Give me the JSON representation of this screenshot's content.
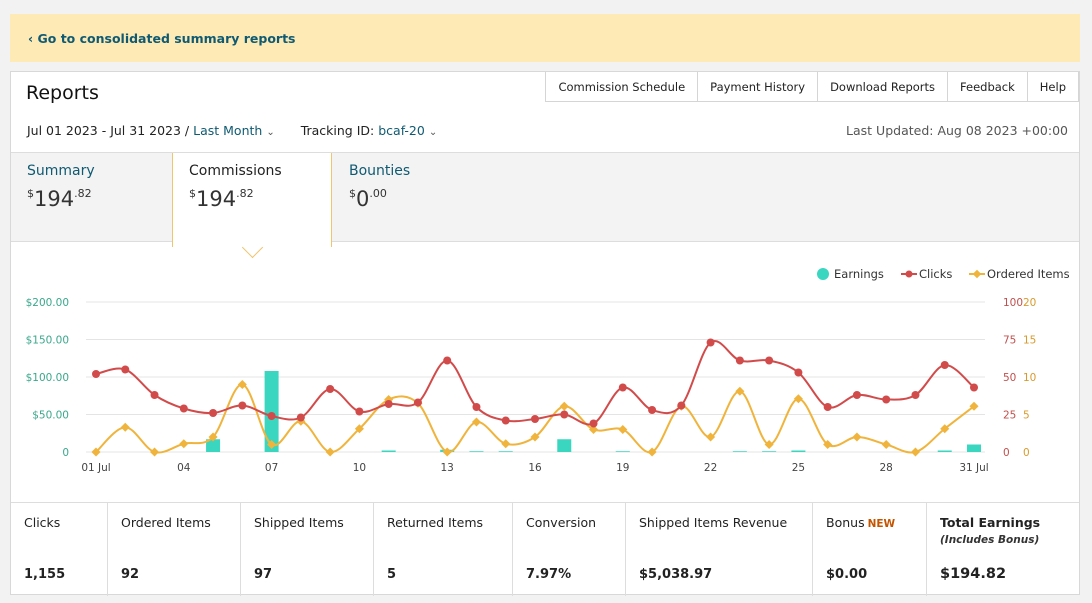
{
  "banner": {
    "link_text": "‹ Go to consolidated summary reports"
  },
  "header": {
    "title": "Reports",
    "nav": [
      "Commission Schedule",
      "Payment History",
      "Download Reports",
      "Feedback",
      "Help"
    ]
  },
  "filters": {
    "date_range": "Jul 01 2023 - Jul 31 2023 /",
    "period": "Last Month",
    "tracking_label": "Tracking ID:",
    "tracking_id": "bcaf-20",
    "last_updated": "Last Updated: Aug 08 2023 +00:00"
  },
  "tabs": [
    {
      "name": "Summary",
      "currency": "$",
      "whole": "194",
      "cents": ".82"
    },
    {
      "name": "Commissions",
      "currency": "$",
      "whole": "194",
      "cents": ".82"
    },
    {
      "name": "Bounties",
      "currency": "$",
      "whole": "0",
      "cents": ".00"
    }
  ],
  "colors": {
    "earnings": "#3ad6c0",
    "clicks": "#d24b4b",
    "ordered": "#f0b43c",
    "link": "#0f5a72"
  },
  "chart_data": {
    "type": "bar+line",
    "legend": [
      "Earnings",
      "Clicks",
      "Ordered Items"
    ],
    "legend_position": "top-right",
    "x": [
      "01 Jul",
      "02",
      "03",
      "04",
      "05",
      "06",
      "07",
      "08",
      "09",
      "10",
      "11",
      "12",
      "13",
      "14",
      "15",
      "16",
      "17",
      "18",
      "19",
      "20",
      "21",
      "22",
      "23",
      "24",
      "25",
      "26",
      "27",
      "28",
      "29",
      "30",
      "31 Jul"
    ],
    "x_tick_labels": [
      "01 Jul",
      "04",
      "07",
      "10",
      "13",
      "16",
      "19",
      "22",
      "25",
      "28",
      "31 Jul"
    ],
    "y_left_ticks": [
      "$200.00",
      "$150.00",
      "$100.00",
      "$50.00",
      "0"
    ],
    "y_left_range": [
      0,
      200
    ],
    "y_clicks_ticks": [
      "100",
      "75",
      "50",
      "25",
      "0"
    ],
    "y_clicks_range": [
      0,
      100
    ],
    "y_ordered_ticks": [
      "20",
      "15",
      "10",
      "5",
      "0"
    ],
    "y_ordered_range": [
      0,
      20
    ],
    "grid": true,
    "series": [
      {
        "name": "Earnings",
        "axis": "left",
        "kind": "bar",
        "values": [
          0,
          0,
          0,
          0,
          17,
          0,
          108,
          0,
          0,
          0,
          2,
          0,
          3,
          1,
          1,
          0,
          17,
          0,
          1,
          0,
          0,
          0,
          1,
          1,
          2,
          0,
          0,
          0,
          0,
          2,
          10
        ]
      },
      {
        "name": "Clicks",
        "axis": "clicks",
        "kind": "line",
        "values": [
          52,
          55,
          38,
          29,
          26,
          31,
          24,
          23,
          42,
          27,
          32,
          33,
          61,
          30,
          21,
          22,
          25,
          19,
          43,
          28,
          31,
          73,
          61,
          61,
          53,
          30,
          38,
          35,
          38,
          58,
          43
        ]
      },
      {
        "name": "Ordered Items",
        "axis": "ordered",
        "kind": "line",
        "values": [
          0,
          3.3,
          0,
          1.1,
          2,
          9,
          1,
          4.1,
          0,
          3.1,
          7,
          6.5,
          0,
          4,
          1.1,
          2,
          6.1,
          3,
          3,
          0,
          6.1,
          2,
          8.1,
          1,
          7.1,
          1,
          2,
          1,
          0,
          3.1,
          6.1
        ]
      }
    ]
  },
  "stats": [
    {
      "label": "Clicks",
      "value": "1,155"
    },
    {
      "label": "Ordered Items",
      "value": "92"
    },
    {
      "label": "Shipped Items",
      "value": "97"
    },
    {
      "label": "Returned Items",
      "value": "5"
    },
    {
      "label": "Conversion",
      "value": "7.97%"
    },
    {
      "label": "Shipped Items Revenue",
      "value": "$5,038.97"
    },
    {
      "label": "Bonus",
      "badge": "NEW",
      "value": "$0.00"
    },
    {
      "label": "Total Earnings",
      "sub": "(Includes Bonus)",
      "value": "$194.82"
    }
  ]
}
